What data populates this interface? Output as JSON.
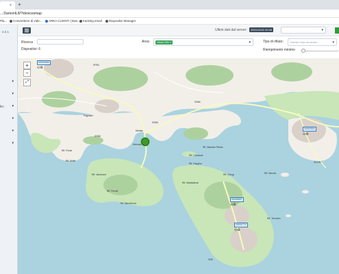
{
  "browser": {
    "tab_label": "",
    "tab_close": "×",
    "new_tab": "+",
    "url": "...:DamonIL8/?/devicesmap",
    "bookmarks": [
      "Pla...",
      "Convertitore di vide...",
      "AREA CLIENTI | Ban...",
      "tracking email",
      "Dispositivi Manager"
    ]
  },
  "sidebar": {
    "version": "2.2.1",
    "items": [
      {
        "label": "",
        "chevron": "▾"
      },
      {
        "label": "",
        "chevron": "▾"
      },
      {
        "label": "fici",
        "chevron": "▾"
      },
      {
        "label": "",
        "chevron": "▾"
      },
      {
        "label": "",
        "chevron": "▾"
      },
      {
        "label": "",
        "chevron": "▾"
      }
    ]
  },
  "header": {
    "menu_icon": "hamburger-icon",
    "server_label": "Ultimi dati dal server:",
    "server_date": "25/01/2022 09:20",
    "select_chevron": "▾"
  },
  "filters": {
    "search_label": "Ricerca",
    "devices_count": "Dispositivi: 6",
    "area_label": "Area:",
    "area_tag": "Vicari 230",
    "area_tag_remove": "×",
    "area_chevron": "▾",
    "waste_label": "Tipo di rifiuto:",
    "waste_placeholder": "Inserisci il tipo da cercare",
    "waste_chevron": "▾",
    "fill_label": "Riempimento minimo",
    "fill_min": 0
  },
  "map": {
    "zoom_in": "+",
    "zoom_out": "−",
    "fullscreen": "⤢",
    "places": [
      "SP83",
      "Pagliaeri",
      "Melata",
      "Mercato",
      "SS58",
      "SS66",
      "SS58",
      "Rif. Ponte",
      "Rif. Boffa",
      "Rif. Varonone",
      "Rif. Ferrali",
      "Rif. Barcellona",
      "Rif. Carotone",
      "Rif. Maestro Pelosi",
      "Rif. Fangino",
      "Rif. Maddalena",
      "SS125",
      "Rif. Tricolore",
      "Rif. Giorgi",
      "Rif. Macolo",
      "SS6"
    ],
    "markers": [
      {
        "code": "00000366",
        "icons": "⊙♻"
      },
      {
        "code": "00002516",
        "icons": "⊙♻"
      },
      {
        "code": "00008087",
        "icons": "⊙♻"
      },
      {
        "code": "00002774",
        "icons": "⊙♻"
      }
    ],
    "colors": {
      "water": "#aad3df",
      "land": "#f2efe9",
      "wood": "#add19e",
      "park": "#c8facc",
      "urban": "#d9d0c9",
      "road": "#f7fabf"
    }
  }
}
